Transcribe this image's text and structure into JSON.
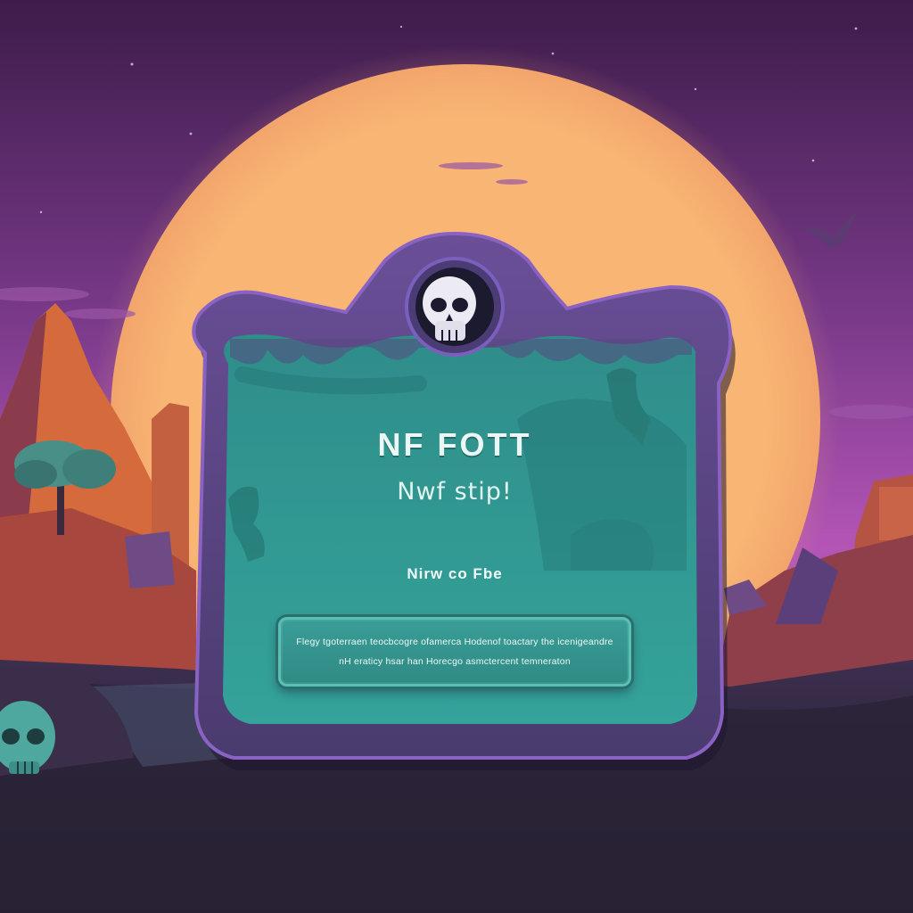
{
  "panel": {
    "title": "NF  FOTT",
    "subtitle": "Nwf stip!",
    "caption": "Nirw co Fbe",
    "message_line_1": "Flegy  tgoterraen teocbcogre ofamerca  Hodenof toactary  the  icenigeandre",
    "message_line_2": "nH eraticy  hsar  han  Horecgo  asmctercent  temneraton"
  },
  "icons": {
    "emblem": "skull-icon",
    "corner_decoration": "skull-icon",
    "sky_creature": "bat-icon"
  },
  "colors": {
    "sky_top": "#3d1c4a",
    "sky_bottom": "#c45fb9",
    "moon": "#f7b372",
    "panel_frame": "#5e4a86",
    "panel_face": "#2f9a94",
    "button_border": "#57c1b6"
  }
}
